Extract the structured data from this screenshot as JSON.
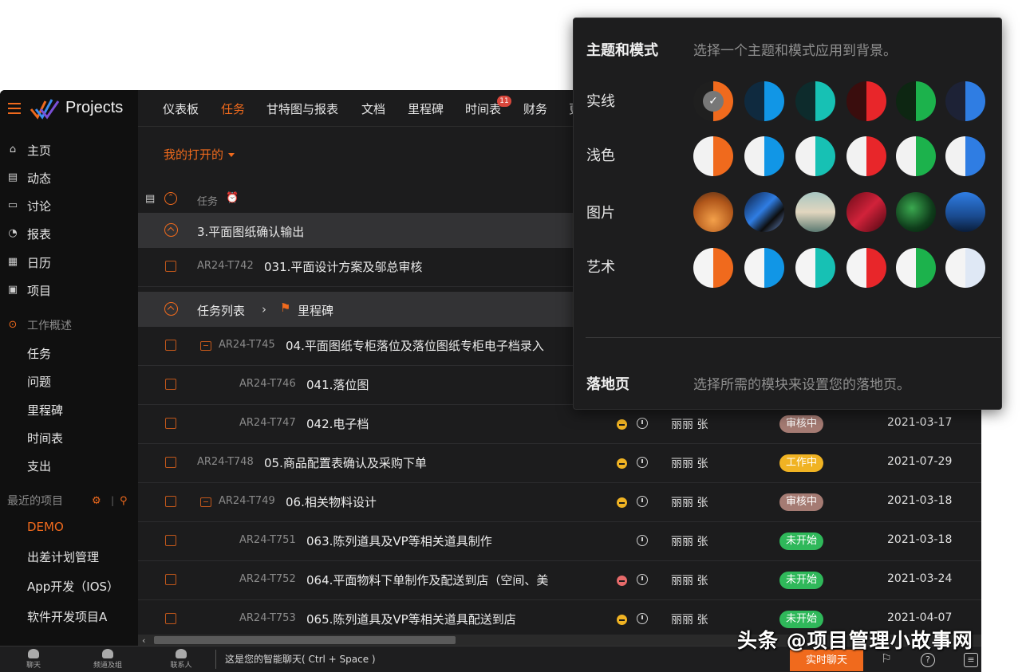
{
  "app": {
    "name": "Projects"
  },
  "topnav": {
    "tabs": [
      {
        "label": "仪表板"
      },
      {
        "label": "任务"
      },
      {
        "label": "甘特图与报表"
      },
      {
        "label": "文档"
      },
      {
        "label": "里程碑"
      },
      {
        "label": "时间表",
        "badge": "11"
      },
      {
        "label": "财务"
      },
      {
        "label": "更"
      }
    ]
  },
  "sidebar": {
    "main_items": [
      {
        "label": "主页",
        "icon": "home-icon"
      },
      {
        "label": "动态",
        "icon": "feed-icon"
      },
      {
        "label": "讨论",
        "icon": "discuss-icon"
      },
      {
        "label": "报表",
        "icon": "report-icon"
      },
      {
        "label": "日历",
        "icon": "calendar-icon"
      },
      {
        "label": "项目",
        "icon": "project-icon"
      }
    ],
    "work_overview": {
      "title": "工作概述",
      "items": [
        {
          "label": "任务"
        },
        {
          "label": "问题"
        },
        {
          "label": "里程碑"
        },
        {
          "label": "时间表"
        },
        {
          "label": "支出"
        }
      ]
    },
    "recent": {
      "title": "最近的项目",
      "items": [
        {
          "label": "DEMO"
        },
        {
          "label": "出差计划管理"
        },
        {
          "label": "App开发（IOS）"
        },
        {
          "label": "软件开发项目A"
        }
      ]
    }
  },
  "content": {
    "filter_label": "我的打开的",
    "task_column_label": "任务",
    "group1": "3.平面图纸确认输出",
    "group2": {
      "list": "任务列表",
      "milestone": "里程碑"
    },
    "tasks": [
      {
        "id": "AR24-T742",
        "name": "031.平面设计方案及邬总审核"
      },
      {
        "id": "AR24-T745",
        "name": "04.平面图纸专柜落位及落位图纸专柜电子档录入"
      },
      {
        "id": "AR24-T746",
        "name": "041.落位图"
      },
      {
        "id": "AR24-T747",
        "name": "042.电子档",
        "assignee": "丽丽 张",
        "status": "审核中",
        "due": "2021-03-17"
      },
      {
        "id": "AR24-T748",
        "name": "05.商品配置表确认及采购下单",
        "assignee": "丽丽 张",
        "status": "工作中",
        "due": "2021-07-29"
      },
      {
        "id": "AR24-T749",
        "name": "06.相关物料设计",
        "assignee": "丽丽 张",
        "status": "审核中",
        "due": "2021-03-18"
      },
      {
        "id": "AR24-T751",
        "name": "063.陈列道具及VP等相关道具制作",
        "assignee": "丽丽 张",
        "status": "未开始",
        "due": "2021-03-18"
      },
      {
        "id": "AR24-T752",
        "name": "064.平面物料下单制作及配送到店（空间、美",
        "assignee": "丽丽 张",
        "status": "未开始",
        "due": "2021-03-24"
      },
      {
        "id": "AR24-T753",
        "name": "065.陈列道具及VP等相关道具配送到店",
        "assignee": "丽丽 张",
        "status": "未开始",
        "due": "2021-04-07"
      }
    ]
  },
  "bottombar": {
    "buttons": [
      {
        "label": "聊天"
      },
      {
        "label": "频道及组"
      },
      {
        "label": "联系人"
      }
    ],
    "chat_prompt": "这是您的智能聊天( Ctrl + Space )",
    "livechat": "实时聊天"
  },
  "theme_panel": {
    "title": "主题和模式",
    "description": "选择一个主题和模式应用到背景。",
    "rows": [
      {
        "label": "实线"
      },
      {
        "label": "浅色"
      },
      {
        "label": "图片"
      },
      {
        "label": "艺术"
      }
    ],
    "landing_title": "落地页",
    "landing_description": "选择所需的模块来设置您的落地页。"
  },
  "watermark": "头条 @项目管理小故事网",
  "colors": {
    "accent": "#f06a1d",
    "status_review": "#a57b73",
    "status_working": "#f0b323",
    "status_notstarted": "#2fb85a",
    "priority_medium": "#f0b323",
    "priority_high": "#e66a6a"
  }
}
